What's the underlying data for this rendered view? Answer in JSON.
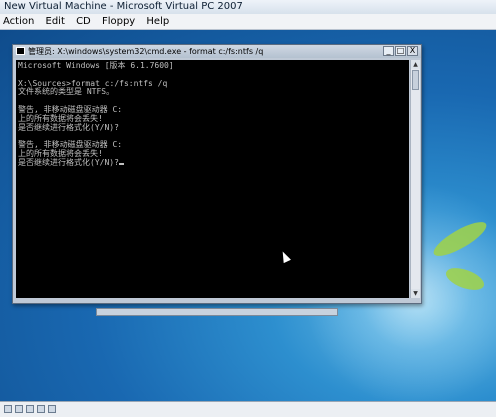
{
  "host": {
    "title": "New Virtual Machine - Microsoft Virtual PC 2007",
    "menu": [
      "Action",
      "Edit",
      "CD",
      "Floppy",
      "Help"
    ]
  },
  "cmd": {
    "title": "管理员: X:\\windows\\system32\\cmd.exe - format c:/fs:ntfs /q",
    "buttons": {
      "minimize": "_",
      "maximize": "□",
      "close": "X"
    },
    "console_lines": [
      "Microsoft Windows [版本 6.1.7600]",
      "",
      "X:\\Sources>format c:/fs:ntfs /q",
      "文件系统的类型是 NTFS。",
      "",
      "警告, 非移动磁盘驱动器 C:",
      "上的所有数据将会丢失!",
      "是否继续进行格式化(Y/N)?",
      "",
      "警告, 非移动磁盘驱动器 C:",
      "上的所有数据将会丢失!",
      "是否继续进行格式化(Y/N)?"
    ]
  },
  "icons": [
    "terminal-icon",
    "mouse-pointer-icon",
    "scroll-up-icon",
    "scroll-down-icon"
  ]
}
